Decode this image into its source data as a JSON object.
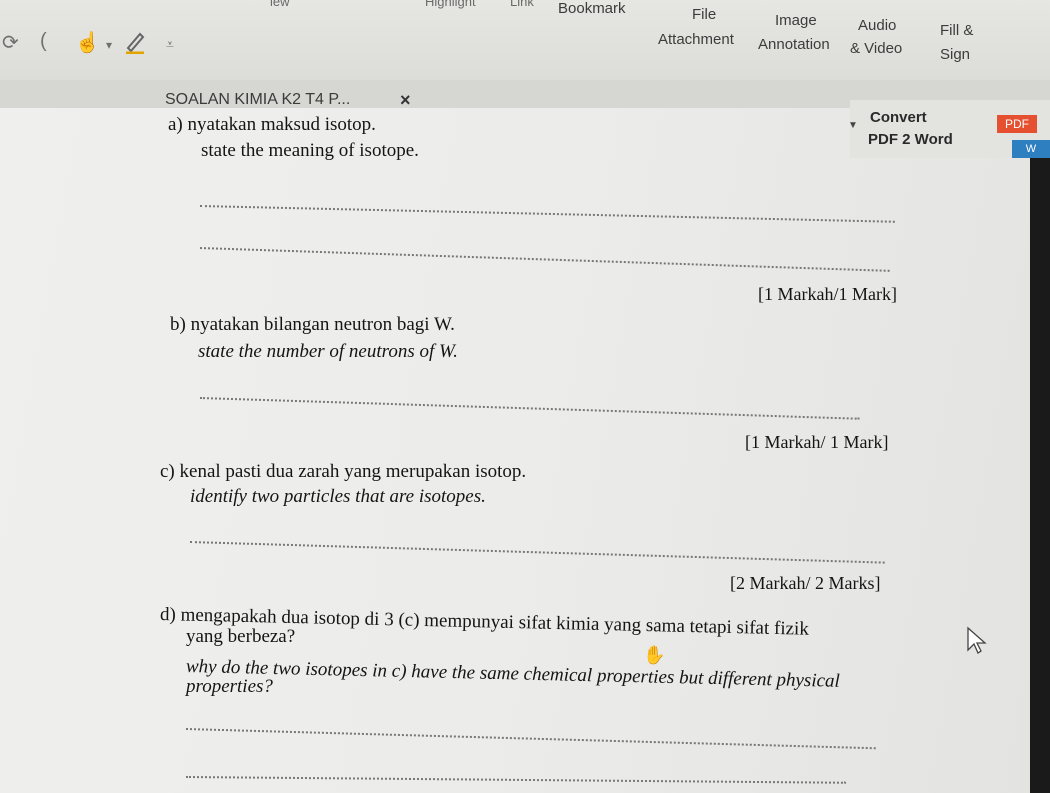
{
  "ribbon": {
    "top_cut": [
      "iew",
      "Highlight",
      "Link"
    ],
    "bookmark": "Bookmark",
    "file_attachment": [
      "File",
      "Attachment"
    ],
    "image_annotation": [
      "Image",
      "Annotation"
    ],
    "audio_video": [
      "Audio",
      "& Video"
    ],
    "fill_sign": [
      "Fill &",
      "Sign"
    ]
  },
  "tab": {
    "title": "SOALAN KIMIA K2 T4 P...",
    "close": "×"
  },
  "convert": {
    "line1": "Convert",
    "line2": "PDF 2 Word",
    "pdf_badge": "PDF",
    "word_badge": "W"
  },
  "questions": {
    "a": {
      "ms": "a)  nyatakan maksud isotop.",
      "en": "state the meaning of isotope.",
      "mark": "[1 Markah/1 Mark]"
    },
    "b": {
      "ms": "b)  nyatakan bilangan neutron bagi W.",
      "en": "state the number of neutrons of W.",
      "mark": "[1 Markah/ 1 Mark]"
    },
    "c": {
      "ms": "c)  kenal pasti dua zarah yang merupakan isotop.",
      "en": "identify two particles that are isotopes.",
      "mark": "[2 Markah/ 2 Marks]"
    },
    "d": {
      "ms1": "d)  mengapakah dua isotop di 3 (c) mempunyai sifat kimia yang sama tetapi sifat fizik",
      "ms2": "yang berbeza?",
      "en1": "why do the two isotopes in c) have the same chemical properties but different physical",
      "en2": "properties?"
    }
  }
}
